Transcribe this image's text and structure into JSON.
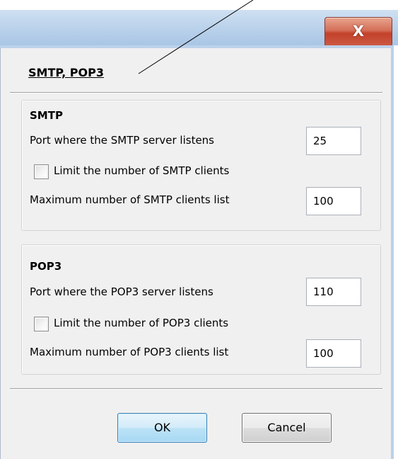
{
  "window": {
    "close_glyph": "X"
  },
  "page": {
    "title": "SMTP, POP3"
  },
  "smtp": {
    "group_title": "SMTP",
    "port_label": "Port where the SMTP server listens",
    "port_value": "25",
    "limit_label": "Limit the number of SMTP clients",
    "limit_checked": false,
    "max_label": "Maximum number of SMTP clients list",
    "max_value": "100"
  },
  "pop3": {
    "group_title": "POP3",
    "port_label": "Port where the POP3 server listens",
    "port_value": "110",
    "limit_label": "Limit the number of POP3 clients",
    "limit_checked": false,
    "max_label": "Maximum number of POP3 clients list",
    "max_value": "100"
  },
  "buttons": {
    "ok": "OK",
    "cancel": "Cancel"
  },
  "colors": {
    "ok_border": "#3c7fb1",
    "close_button": "#c3412a",
    "title_bar": "#b9d1ea"
  }
}
